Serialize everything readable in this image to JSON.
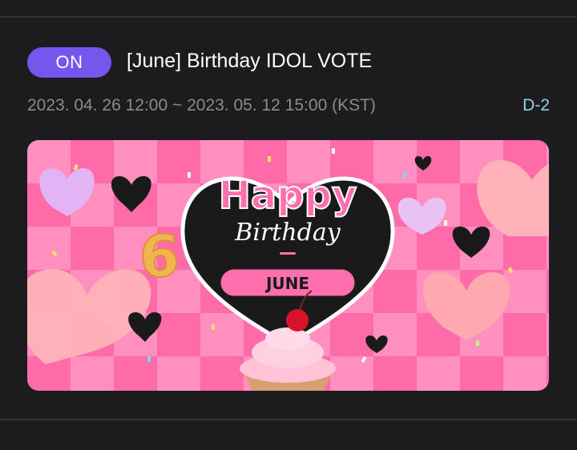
{
  "vote": {
    "status": "ON",
    "title": "[June] Birthday IDOL VOTE",
    "period": "2023. 04. 26 12:00 ~ 2023. 05. 12 15:00 (KST)",
    "dday": "D-2"
  },
  "banner": {
    "headline": "Happy",
    "subline": "Birthday",
    "number": "6",
    "month": "JUNE"
  },
  "colors": {
    "accent": "#7557ee",
    "dday": "#8fd2f2",
    "banner_pink": "#ff6aa8",
    "banner_black": "#1a1a1a"
  }
}
